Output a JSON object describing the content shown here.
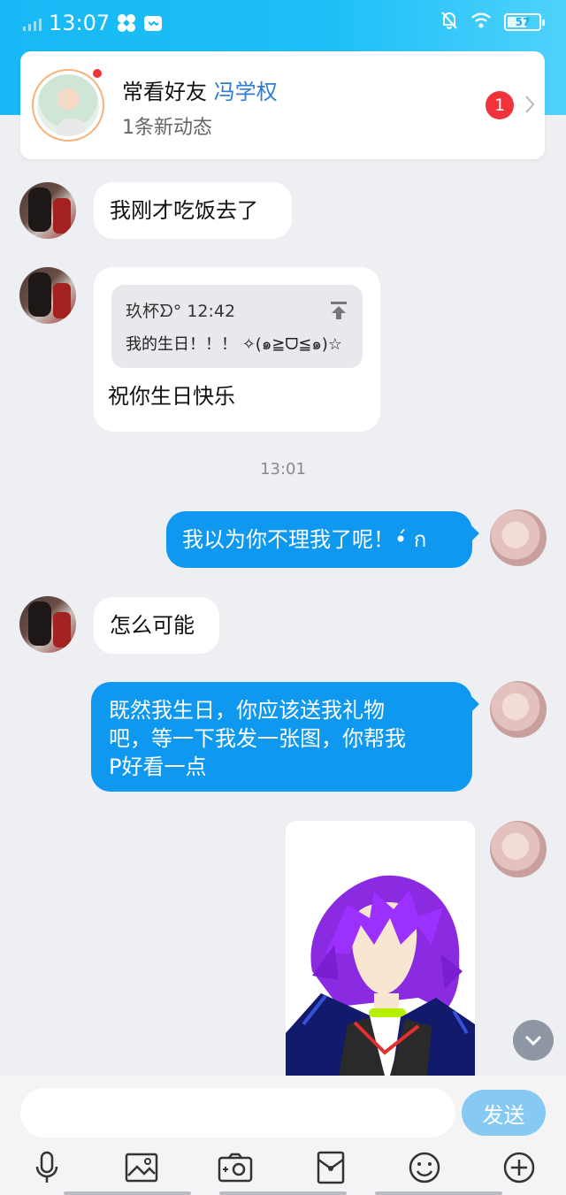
{
  "status_bar": {
    "time": "13:07",
    "battery": "57"
  },
  "friend_card": {
    "title_prefix": "常看好友",
    "friend_name": "冯学权",
    "subtitle": "1条新动态",
    "badge_count": "1"
  },
  "messages": [
    {
      "from": "other",
      "text": "我刚才吃饭去了"
    },
    {
      "from": "other",
      "reply": {
        "sender": "玖杯ᗤ°",
        "time": "12:42",
        "text": "我的生日！！！ ✧(๑≧ᗜ≦๑)☆"
      },
      "text": "祝你生日快乐"
    },
    {
      "type": "timestamp",
      "text": "13:01"
    },
    {
      "from": "self",
      "text": "我以为你不理我了呢！•́ ก"
    },
    {
      "from": "other",
      "text": "怎么可能"
    },
    {
      "from": "self",
      "lines": [
        "既然我生日，你应该送我礼物",
        "吧，等一下我发一张图，你帮我",
        "P好看一点"
      ]
    },
    {
      "from": "self",
      "type": "image",
      "image_icon": "anime-character-purple-hair"
    }
  ],
  "input": {
    "placeholder": "",
    "send_label": "发送"
  },
  "toolbar": {
    "icons": [
      "microphone-icon",
      "image-icon",
      "camera-icon",
      "red-packet-icon",
      "emoji-icon",
      "plus-icon"
    ]
  },
  "colors": {
    "accent": "#0f98f0",
    "header": "#16b9f5",
    "badge": "#f0323a",
    "send_button": "#86c9f3"
  }
}
